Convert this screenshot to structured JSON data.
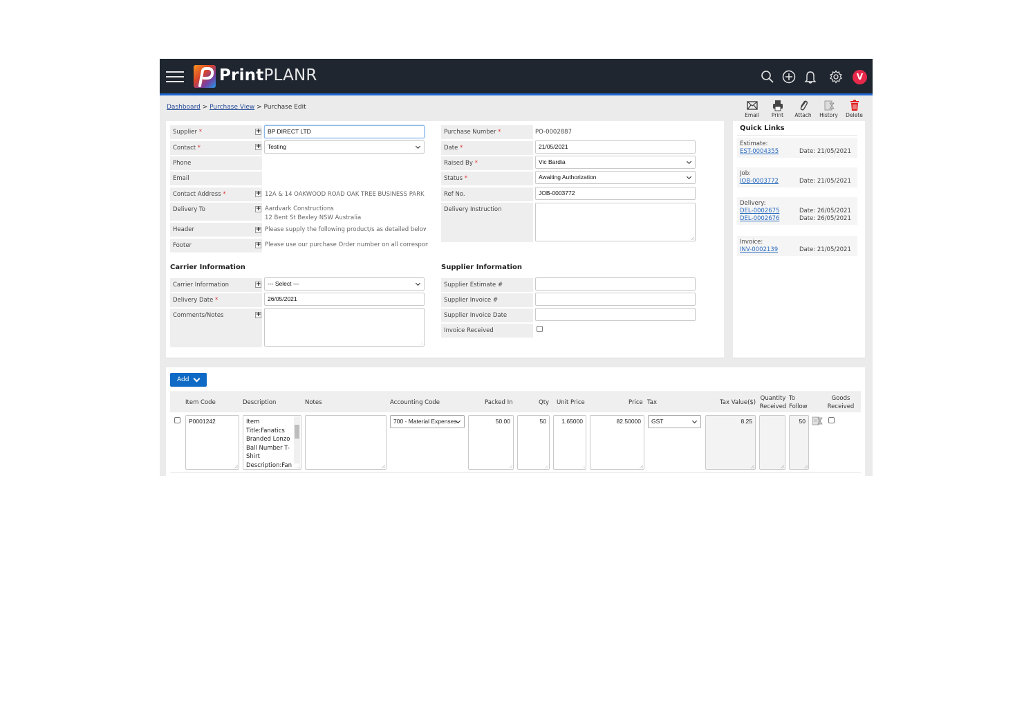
{
  "header": {
    "brand_bold": "Print",
    "brand_light": "PLANR",
    "icons": [
      "search-icon",
      "add-circle-icon",
      "bell-icon",
      "gear-icon"
    ],
    "avatar_initial": "V",
    "accent": "#1e66d0"
  },
  "breadcrumb": {
    "items": [
      "Dashboard",
      "Purchase View"
    ],
    "separator": ">",
    "current": "Purchase Edit"
  },
  "actions": [
    {
      "label": "Email",
      "icon": "envelope-icon"
    },
    {
      "label": "Print",
      "icon": "printer-icon"
    },
    {
      "label": "Attach",
      "icon": "paperclip-icon"
    },
    {
      "label": "History",
      "icon": "history-icon"
    },
    {
      "label": "Delete",
      "icon": "trash-icon",
      "color": "#e02020"
    }
  ],
  "supplier_form": {
    "supplier": {
      "label": "Supplier",
      "value": "BP DIRECT LTD"
    },
    "contact": {
      "label": "Contact",
      "value": "Testing"
    },
    "phone": {
      "label": "Phone",
      "value": ""
    },
    "email": {
      "label": "Email",
      "value": ""
    },
    "contact_address": {
      "label": "Contact Address",
      "value": "12A & 14 OAKWOOD ROAD OAK TREE BUSINESS PARK MANSFIELD"
    },
    "delivery_to": {
      "label": "Delivery To",
      "line1": "Aardvark Constructions",
      "line2": "12 Bent St Bexley NSW Australia"
    },
    "header": {
      "label": "Header",
      "value": "Please supply the following product/s as detailed below:"
    },
    "footer": {
      "label": "Footer",
      "value": "Please use our purchase Order number on all correspondence"
    }
  },
  "purchase_form": {
    "purchase_number": {
      "label": "Purchase Number",
      "value": "PO-0002887"
    },
    "date": {
      "label": "Date",
      "value": "21/05/2021"
    },
    "raised_by": {
      "label": "Raised By",
      "value": "Vic Bardia"
    },
    "status": {
      "label": "Status",
      "value": "Awaiting Authorization"
    },
    "ref_no": {
      "label": "Ref No.",
      "value": "JOB-0003772"
    },
    "delivery_instruction": {
      "label": "Delivery Instruction",
      "value": ""
    }
  },
  "carrier": {
    "title": "Carrier Information",
    "carrier_info": {
      "label": "Carrier Information",
      "value": "--- Select ---"
    },
    "delivery_date": {
      "label": "Delivery Date",
      "value": "26/05/2021"
    },
    "comments": {
      "label": "Comments/Notes",
      "value": ""
    }
  },
  "supplier_info": {
    "title": "Supplier Information",
    "estimate": {
      "label": "Supplier Estimate #",
      "value": ""
    },
    "invoice": {
      "label": "Supplier Invoice #",
      "value": ""
    },
    "invoice_date": {
      "label": "Supplier Invoice Date",
      "value": ""
    },
    "invoice_received": {
      "label": "Invoice Received",
      "checked": false
    }
  },
  "quick_links": {
    "title": "Quick Links",
    "groups": [
      {
        "type": "Estimate:",
        "links": [
          {
            "id": "EST-0004355",
            "date": "Date: 21/05/2021"
          }
        ]
      },
      {
        "type": "Job:",
        "links": [
          {
            "id": "JOB-0003772",
            "date": "Date: 21/05/2021"
          }
        ]
      },
      {
        "type": "Delivery:",
        "links": [
          {
            "id": "DEL-0002675",
            "date": "Date: 26/05/2021"
          },
          {
            "id": "DEL-0002676",
            "date": "Date: 26/05/2021"
          }
        ]
      },
      {
        "type": "Invoice:",
        "links": [
          {
            "id": "INV-0002139",
            "date": "Date: 21/05/2021"
          }
        ]
      }
    ]
  },
  "items": {
    "add_label": "Add",
    "columns": [
      "Item Code",
      "Description",
      "Notes",
      "Accounting Code",
      "Packed In",
      "Qty",
      "Unit Price",
      "Price",
      "Tax",
      "Tax Value($)",
      "Quantity Received",
      "To Follow",
      "Goods Received"
    ],
    "rows": [
      {
        "item_code": "P0001242",
        "description": "Item Title:Fanatics Branded Lonzo Ball Number T-Shirt Description:Fan",
        "notes": "",
        "accounting_code": "700 - Material Expenses",
        "packed_in": "50.00",
        "qty": "50",
        "unit_price": "1.65000",
        "price": "82.50000",
        "tax": "GST",
        "tax_value": "8.25",
        "quantity_received": "",
        "to_follow": "50",
        "goods_received": false
      }
    ]
  }
}
